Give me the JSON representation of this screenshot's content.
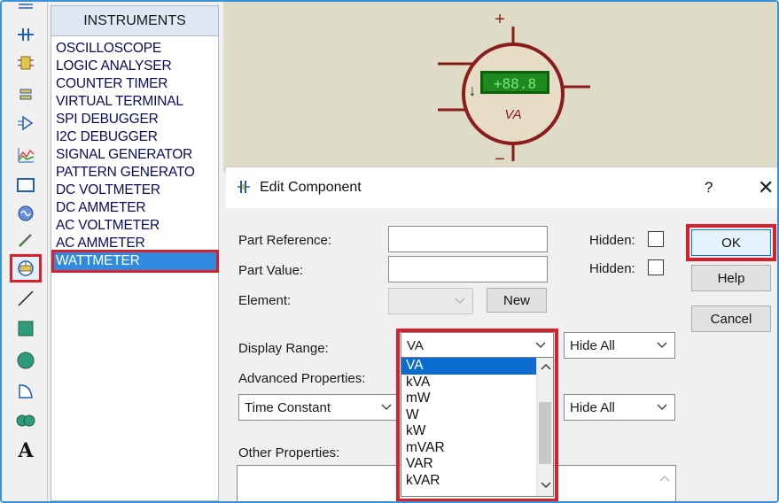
{
  "instruments_panel": {
    "header": "INSTRUMENTS",
    "items": [
      "OSCILLOSCOPE",
      "LOGIC ANALYSER",
      "COUNTER TIMER",
      "VIRTUAL TERMINAL",
      "SPI DEBUGGER",
      "I2C DEBUGGER",
      "SIGNAL GENERATOR",
      "PATTERN GENERATO",
      "DC VOLTMETER",
      "DC AMMETER",
      "AC VOLTMETER",
      "AC AMMETER",
      "WATTMETER"
    ],
    "selected": "WATTMETER"
  },
  "schematic": {
    "meter_display": "+88.8",
    "meter_unit": "VA",
    "plus_sign": "+",
    "minus_sign": "−",
    "current_arrow": "↓"
  },
  "dialog": {
    "title": "Edit Component",
    "help_glyph": "?",
    "close_glyph": "✕",
    "part_reference_label": "Part Reference:",
    "part_reference_value": "",
    "part_value_label": "Part Value:",
    "part_value_value": "",
    "hidden_label_1": "Hidden:",
    "hidden_label_2": "Hidden:",
    "element_label": "Element:",
    "new_button": "New",
    "display_range_label": "Display Range:",
    "display_range_value": "VA",
    "display_range_options": [
      "VA",
      "kVA",
      "mW",
      "W",
      "kW",
      "mVAR",
      "VAR",
      "kVAR"
    ],
    "hide_all_1": "Hide All",
    "advanced_properties_label": "Advanced Properties:",
    "advanced_property_value": "Time Constant",
    "hide_all_2": "Hide All",
    "other_properties_label": "Other Properties:",
    "ok_button": "OK",
    "help_button": "Help",
    "cancel_button": "Cancel"
  },
  "colors": {
    "highlight_red": "#d9202a",
    "selection_blue": "#2f8be0",
    "meter_red": "#8b1c1c",
    "meter_display_green": "#1c8a1c",
    "canvas_bg": "#dedcc6"
  }
}
